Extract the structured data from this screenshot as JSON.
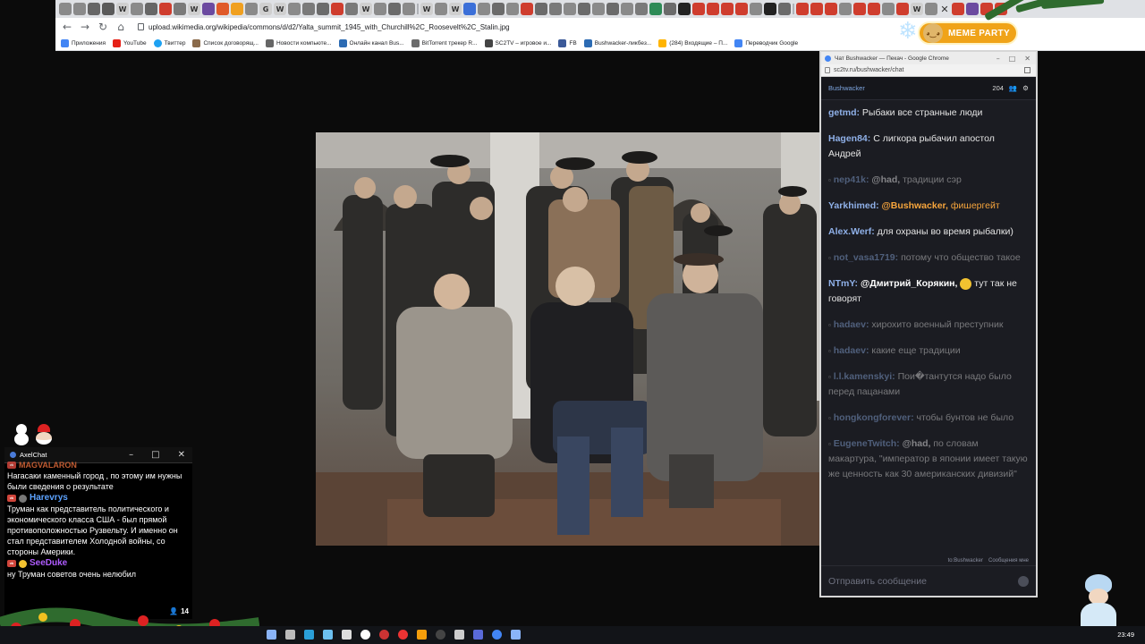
{
  "browser": {
    "url": "upload.wikimedia.org/wikipedia/commons/d/d2/Yalta_summit_1945_with_Churchill%2C_Roosevelt%2C_Stalin.jpg",
    "bookmarks": [
      "Приложения",
      "YouTube",
      "Твиттер",
      "Список договорящ...",
      "Новости компьюте...",
      "Онлайн канал Bus...",
      "BitTorrent трекер R...",
      "SC2TV – игровое и...",
      "FB",
      "Bushwacker-ликбез...",
      "(284) Входящие – П...",
      "Переводчик Google"
    ]
  },
  "decor": {
    "meme_party": "MEME PARTY"
  },
  "chat_popup": {
    "window_title": "Чат Bushwacker — Пекач - Google Chrome",
    "url": "sc2tv.ru/bushwacker/chat",
    "channel": "Bushwacker",
    "viewers": "204",
    "footer_links": [
      "to:Bushwacker",
      "Сообщения мне"
    ],
    "input_placeholder": "Отправить сообщение",
    "messages": [
      {
        "nick": "getmd:",
        "text": "Рыбаки все странные люди",
        "dim": false
      },
      {
        "nick": "Hagen84:",
        "text": "С лигкора рыбачил апостол Андрей",
        "dim": false
      },
      {
        "nick": "nep41k:",
        "mention": "@had,",
        "text": "традиции сэр",
        "dim": true
      },
      {
        "nick": "Yarkhimed:",
        "mention": "@Bushwacker,",
        "text": "фишергейт",
        "dim": false,
        "highlight": true
      },
      {
        "nick": "Alex.Werf:",
        "text": "для охраны во время рыбалки)",
        "dim": false
      },
      {
        "nick": "not_vasa1719:",
        "text": "потому что общество такое",
        "dim": true
      },
      {
        "nick": "NTmY:",
        "mention": "@Дмитрий_Корякин,",
        "text": "тут так не говорят",
        "dim": false
      },
      {
        "nick": "hadaev:",
        "text": "хирохито военный преступник",
        "dim": true
      },
      {
        "nick": "hadaev:",
        "text": "какие еще традиции",
        "dim": true
      },
      {
        "nick": "l.l.kamenskyi:",
        "text": "Пои�тантутся надо было перед пацанами",
        "dim": true
      },
      {
        "nick": "hongkongforever:",
        "text": "чтобы бунтов не было",
        "dim": true
      },
      {
        "nick": "EugeneTwitch:",
        "mention": "@had,",
        "text": "по словам макартура, \"император в японии имеет такую же ценность как 30 американских дивизий\"",
        "dim": true
      }
    ]
  },
  "axelchat": {
    "title": "AxelChat",
    "messages": [
      {
        "author": "magvalaron",
        "text": "Нагасаки каменный город , по этому им нужны были сведения о результате",
        "color": "#e06a3a"
      },
      {
        "author": "Harevrys",
        "text": "Труман как представитель политического и экономического класса США - был прямой противоположностью Рузвельту. И именно он стал представителем Холодной войны, со стороны Америки.",
        "color": "#5ca2ff"
      },
      {
        "author": "SeeDuke",
        "text": "ну Труман советов очень нелюбил",
        "color": "#b05cff"
      }
    ],
    "viewer_count": "14"
  },
  "taskbar": {
    "clock": "23:49"
  }
}
